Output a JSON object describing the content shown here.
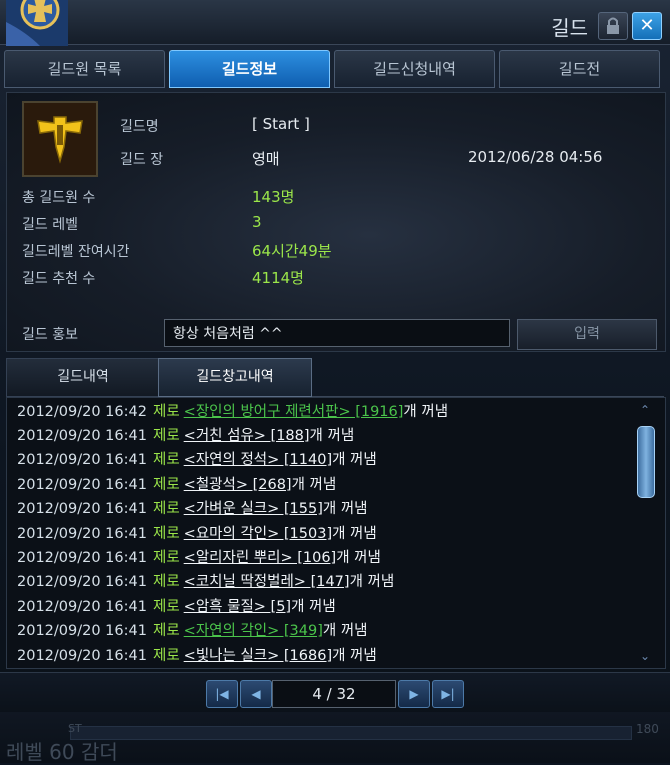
{
  "window": {
    "title": "길드"
  },
  "tabs": [
    "길드원 목록",
    "길드정보",
    "길드신청내역",
    "길드전"
  ],
  "active_tab": 1,
  "guild_info": {
    "name_label": "길드명",
    "name_value": "[ Start ]",
    "leader_label": "길드 장",
    "leader_value": "영매",
    "founded": "2012/06/28 04:56",
    "members_label": "총 길드원 수",
    "members_value": "143명",
    "level_label": "길드 레벨",
    "level_value": "3",
    "time_label": "길드레벨 잔여시간",
    "time_value": "64시간49분",
    "recommend_label": "길드 추천 수",
    "recommend_value": "4114명"
  },
  "promo": {
    "label": "길드 홍보",
    "value": "항상 처음처럼 ^^",
    "button": "입력"
  },
  "subtabs": [
    "길드내역",
    "길드창고내역"
  ],
  "active_subtab": 1,
  "log": [
    {
      "time": "2012/09/20 16:42",
      "actor": "제로",
      "item": "<장인의 방어구 제련서판> [1916]",
      "suffix": "개 꺼냄",
      "color": "green"
    },
    {
      "time": "2012/09/20 16:41",
      "actor": "제로",
      "item": "<거친 섬유> [188]",
      "suffix": "개 꺼냄",
      "color": "white"
    },
    {
      "time": "2012/09/20 16:41",
      "actor": "제로",
      "item": "<자연의 정석> [1140]",
      "suffix": "개 꺼냄",
      "color": "white"
    },
    {
      "time": "2012/09/20 16:41",
      "actor": "제로",
      "item": "<철광석> [268]",
      "suffix": "개 꺼냄",
      "color": "white"
    },
    {
      "time": "2012/09/20 16:41",
      "actor": "제로",
      "item": "<가벼운 실크> [155]",
      "suffix": "개 꺼냄",
      "color": "white"
    },
    {
      "time": "2012/09/20 16:41",
      "actor": "제로",
      "item": "<요마의 각인> [1503]",
      "suffix": "개 꺼냄",
      "color": "white"
    },
    {
      "time": "2012/09/20 16:41",
      "actor": "제로",
      "item": "<알리자린 뿌리> [106]",
      "suffix": "개 꺼냄",
      "color": "white"
    },
    {
      "time": "2012/09/20 16:41",
      "actor": "제로",
      "item": "<코치닐 딱정벌레> [147]",
      "suffix": "개 꺼냄",
      "color": "white"
    },
    {
      "time": "2012/09/20 16:41",
      "actor": "제로",
      "item": "<암흑 물질> [5]",
      "suffix": "개 꺼냄",
      "color": "white"
    },
    {
      "time": "2012/09/20 16:41",
      "actor": "제로",
      "item": "<자연의 각인> [349]",
      "suffix": "개 꺼냄",
      "color": "green"
    },
    {
      "time": "2012/09/20 16:41",
      "actor": "제로",
      "item": "<빛나는 실크> [1686]",
      "suffix": "개 꺼냄",
      "color": "white"
    }
  ],
  "pager": {
    "page": "4 / 32"
  },
  "footer": {
    "text": "레벨 60 감더",
    "st": "ST",
    "num": "180"
  },
  "colors": {
    "accent": "#1f7fd0",
    "green": "#9be64a",
    "item_green": "#4bc44b"
  }
}
